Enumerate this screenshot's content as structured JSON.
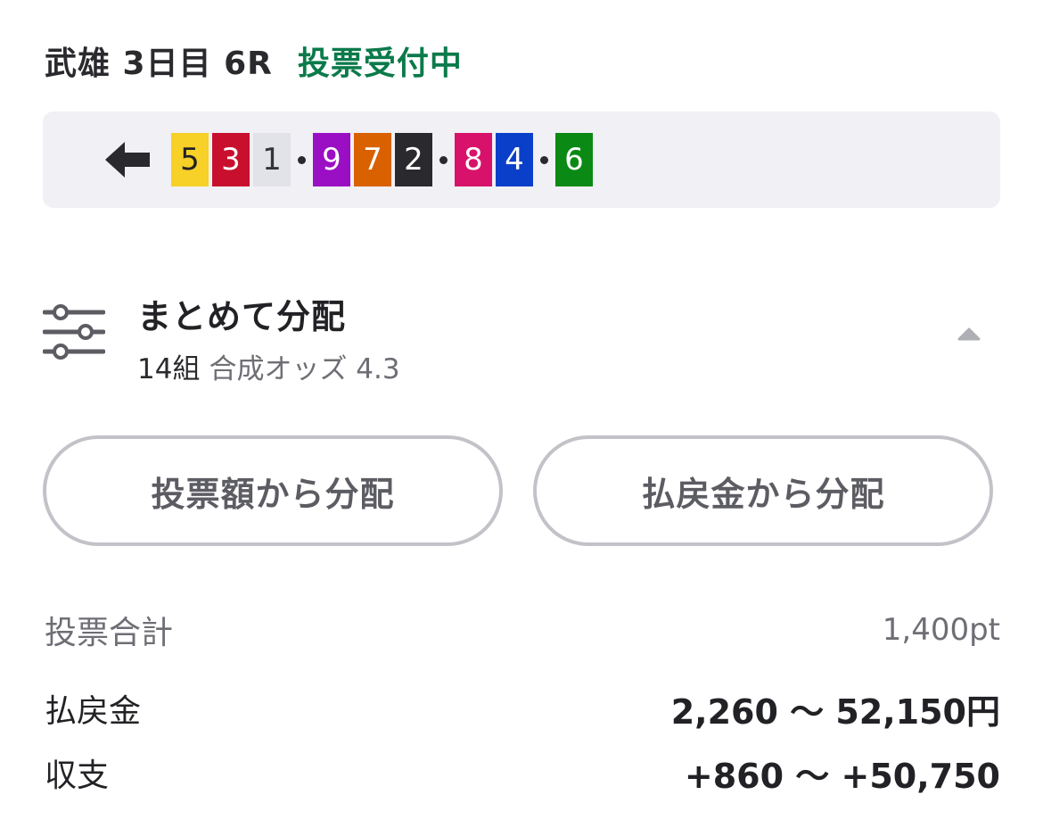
{
  "header": {
    "race_name": "武雄 3日目 6R",
    "status": "投票受付中",
    "status_color": "#0b7a4a"
  },
  "combo": {
    "arrow_icon": "arrow-left-icon",
    "groups": [
      [
        {
          "num": "5",
          "bg": "#f7d028",
          "fg": "#222226"
        },
        {
          "num": "3",
          "bg": "#c8102e",
          "fg": "#ffffff"
        },
        {
          "num": "1",
          "bg": "#e2e3e8",
          "fg": "#333338"
        }
      ],
      [
        {
          "num": "9",
          "bg": "#9a0fc4",
          "fg": "#ffffff"
        },
        {
          "num": "7",
          "bg": "#d96100",
          "fg": "#ffffff"
        },
        {
          "num": "2",
          "bg": "#2a2a2e",
          "fg": "#ffffff"
        }
      ],
      [
        {
          "num": "8",
          "bg": "#d8126a",
          "fg": "#ffffff"
        },
        {
          "num": "4",
          "bg": "#0a3fc9",
          "fg": "#ffffff"
        }
      ],
      [
        {
          "num": "6",
          "bg": "#0a8a14",
          "fg": "#ffffff"
        }
      ]
    ]
  },
  "distribution": {
    "icon": "sliders-icon",
    "title": "まとめて分配",
    "count": "14組",
    "odds": "合成オッズ 4.3",
    "caret_icon": "caret-up-icon"
  },
  "buttons": {
    "by_amount": "投票額から分配",
    "by_payout": "払戻金から分配"
  },
  "summary": {
    "total_label": "投票合計",
    "total_value": "1,400pt",
    "payout_label": "払戻金",
    "payout_value": "2,260 〜 52,150円",
    "balance_label": "収支",
    "balance_value": "+860 〜 +50,750"
  }
}
